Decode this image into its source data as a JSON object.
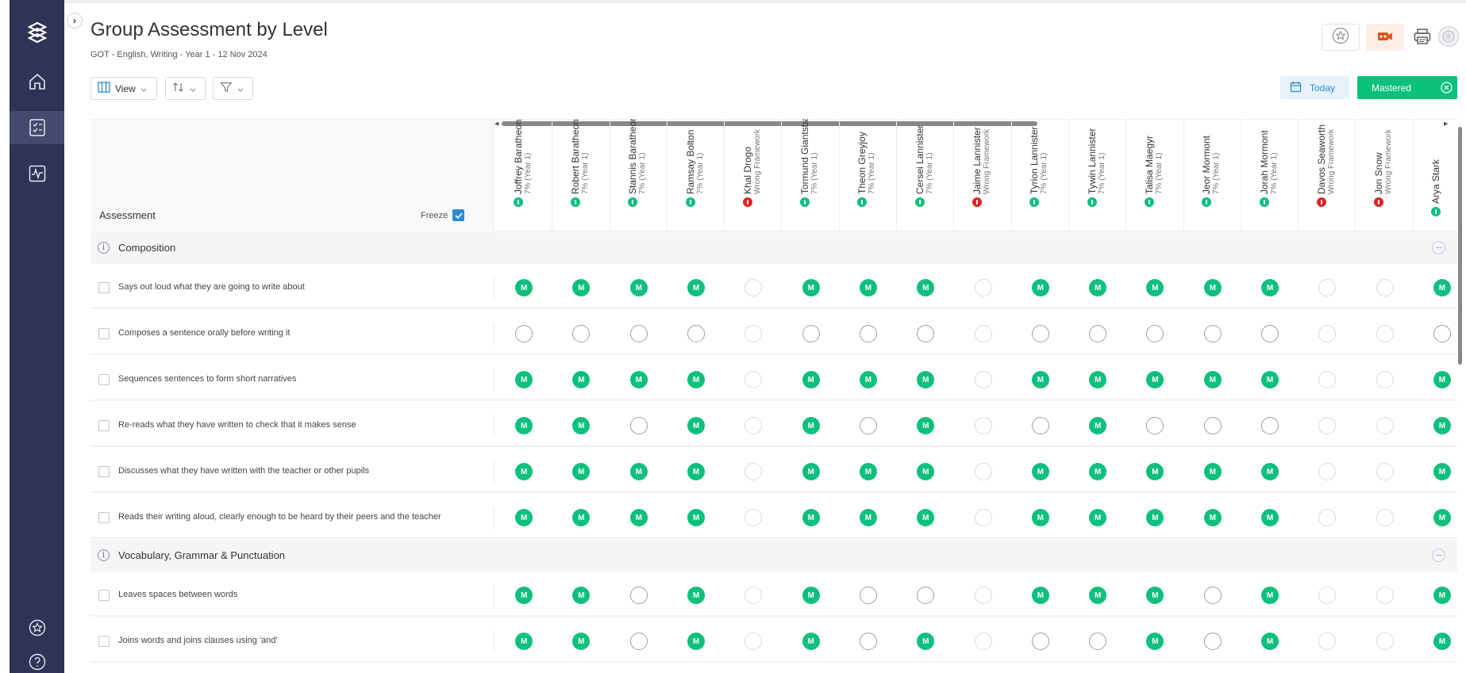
{
  "page": {
    "title": "Group Assessment by Level",
    "subtitle": "GOT - English, Writing - Year 1 - 12 Nov 2024"
  },
  "toolbar": {
    "view_label": "View",
    "today_label": "Today",
    "mastered_label": "Mastered"
  },
  "grid": {
    "assessment_label": "Assessment",
    "freeze_label": "Freeze",
    "freeze_checked": true,
    "students": [
      {
        "name": "Joffrey Baratheon",
        "pct": "7% (Year 1)",
        "status": "green"
      },
      {
        "name": "Robert Baratheon",
        "pct": "7% (Year 1)",
        "status": "green"
      },
      {
        "name": "Stannis Baratheon",
        "pct": "7% (Year 1)",
        "status": "green"
      },
      {
        "name": "Ramsay Bolton",
        "pct": "7% (Year 1)",
        "status": "green"
      },
      {
        "name": "Khal Drogo",
        "pct": "Wrong Framework",
        "status": "red"
      },
      {
        "name": "Tormund Giantsbane",
        "pct": "7% (Year 1)",
        "status": "green"
      },
      {
        "name": "Theon Greyjoy",
        "pct": "7% (Year 1)",
        "status": "green"
      },
      {
        "name": "Cersei Lannister",
        "pct": "7% (Year 1)",
        "status": "green"
      },
      {
        "name": "Jaime Lannister",
        "pct": "Wrong Framework",
        "status": "red"
      },
      {
        "name": "Tyrion Lannister",
        "pct": "7% (Year 1)",
        "status": "green"
      },
      {
        "name": "Tywin Lannister",
        "pct": "7% (Year 1)",
        "status": "green"
      },
      {
        "name": "Talisa Maegyr",
        "pct": "7% (Year 1)",
        "status": "green"
      },
      {
        "name": "Jeor Mormont",
        "pct": "7% (Year 1)",
        "status": "green"
      },
      {
        "name": "Jorah Mormont",
        "pct": "7% (Year 1)",
        "status": "green"
      },
      {
        "name": "Davos Seaworth",
        "pct": "Wrong Framework",
        "status": "red"
      },
      {
        "name": "Jon Snow",
        "pct": "Wrong Framework",
        "status": "red"
      },
      {
        "name": "Arya Stark",
        "pct": "",
        "status": "green"
      }
    ],
    "sections": [
      {
        "title": "Composition",
        "rows": [
          {
            "text": "Says out loud what they are going to write about",
            "cells": [
              "M",
              "M",
              "M",
              "M",
              "x",
              "M",
              "M",
              "M",
              "x",
              "M",
              "M",
              "M",
              "M",
              "M",
              "x",
              "x",
              "M"
            ]
          },
          {
            "text": "Composes a sentence orally before writing it",
            "cells": [
              "o",
              "o",
              "o",
              "o",
              "x",
              "o",
              "o",
              "o",
              "x",
              "o",
              "o",
              "o",
              "o",
              "o",
              "x",
              "x",
              "o"
            ]
          },
          {
            "text": "Sequences sentences to form short narratives",
            "cells": [
              "M",
              "M",
              "M",
              "M",
              "x",
              "M",
              "M",
              "M",
              "x",
              "M",
              "M",
              "M",
              "M",
              "M",
              "x",
              "x",
              "M"
            ]
          },
          {
            "text": "Re-reads what they have written to check that it makes sense",
            "cells": [
              "M",
              "M",
              "o",
              "M",
              "x",
              "M",
              "o",
              "M",
              "x",
              "o",
              "M",
              "o",
              "o",
              "o",
              "x",
              "x",
              "M"
            ]
          },
          {
            "text": "Discusses what they have written with the teacher or other pupils",
            "cells": [
              "M",
              "M",
              "M",
              "M",
              "x",
              "M",
              "M",
              "M",
              "x",
              "M",
              "M",
              "M",
              "M",
              "M",
              "x",
              "x",
              "M"
            ]
          },
          {
            "text": "Reads their writing aloud, clearly enough to be heard by their peers and the teacher",
            "cells": [
              "M",
              "M",
              "M",
              "M",
              "x",
              "M",
              "M",
              "M",
              "x",
              "M",
              "M",
              "M",
              "M",
              "M",
              "x",
              "x",
              "M"
            ]
          }
        ]
      },
      {
        "title": "Vocabulary, Grammar & Punctuation",
        "rows": [
          {
            "text": "Leaves spaces between words",
            "cells": [
              "M",
              "M",
              "o",
              "M",
              "x",
              "M",
              "o",
              "o",
              "x",
              "M",
              "M",
              "M",
              "o",
              "M",
              "x",
              "x",
              "M"
            ]
          },
          {
            "text": "Joins words and joins clauses using 'and'",
            "cells": [
              "M",
              "M",
              "o",
              "M",
              "x",
              "M",
              "o",
              "M",
              "x",
              "o",
              "o",
              "M",
              "o",
              "M",
              "x",
              "x",
              "M"
            ]
          }
        ]
      }
    ],
    "mastered_mark": "M"
  },
  "colors": {
    "sidebar": "#2f3356",
    "mastered_green": "#0dc07b",
    "status_green": "#0dc07b",
    "status_red": "#e02424",
    "accent_blue": "#2a8bd4"
  },
  "icons": {
    "sidebar": [
      "logo-icon",
      "home-icon",
      "assessment-icon",
      "analytics-icon",
      "star-icon",
      "help-icon"
    ],
    "toolbar": [
      "columns-icon",
      "sort-icon",
      "filter-icon",
      "calendar-icon",
      "close-circle-icon"
    ],
    "top_right": [
      "star-icon",
      "video-icon",
      "printer-icon",
      "avatar-icon"
    ]
  }
}
